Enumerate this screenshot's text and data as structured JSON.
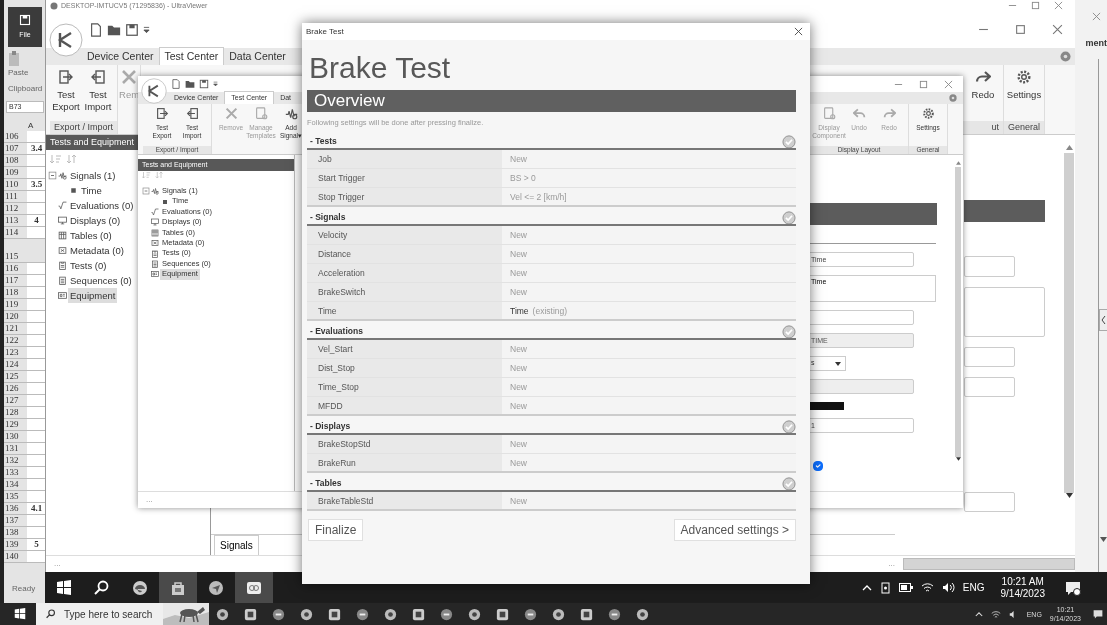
{
  "excel": {
    "file": "File",
    "paste": "Paste",
    "clipboard": "Clipboard",
    "name_box": "B73",
    "column": "A",
    "status": "Ready",
    "rows": [
      {
        "number": "106"
      },
      {
        "number": "107",
        "value": "3.4"
      },
      {
        "number": "108"
      },
      {
        "number": "109"
      },
      {
        "number": "110",
        "value": "3.5"
      },
      {
        "number": "111"
      },
      {
        "number": "112"
      },
      {
        "number": "113",
        "value": "4"
      },
      {
        "number": "114"
      },
      {
        "number": "115",
        "tall": true
      },
      {
        "number": "116"
      },
      {
        "number": "117"
      },
      {
        "number": "118"
      },
      {
        "number": "119"
      },
      {
        "number": "120"
      },
      {
        "number": "121"
      },
      {
        "number": "122"
      },
      {
        "number": "123"
      },
      {
        "number": "124"
      },
      {
        "number": "125"
      },
      {
        "number": "126"
      },
      {
        "number": "127"
      },
      {
        "number": "128"
      },
      {
        "number": "129"
      },
      {
        "number": "130"
      },
      {
        "number": "131"
      },
      {
        "number": "132"
      },
      {
        "number": "133"
      },
      {
        "number": "134"
      },
      {
        "number": "135"
      },
      {
        "number": "136",
        "value": "4.1"
      },
      {
        "number": "137"
      },
      {
        "number": "138"
      },
      {
        "number": "139",
        "value": "5"
      },
      {
        "number": "140"
      }
    ]
  },
  "viewer": {
    "title": "DESKTOP-IMTUCV5 (71295836) - UltraViewer"
  },
  "back_window": {
    "label": "ment"
  },
  "app": {
    "tabs": [
      {
        "label": "Device Center",
        "selected": false
      },
      {
        "label": "Test Center",
        "selected": true
      },
      {
        "label": "Data Center",
        "selected": false
      }
    ],
    "ribbon_groups": [
      {
        "label": "Export / Import",
        "items": [
          {
            "kind": "export",
            "label": "Test Export"
          },
          {
            "kind": "import",
            "label": "Test Import"
          }
        ]
      },
      {
        "items": [
          {
            "kind": "remove",
            "label": "Rem",
            "disabled": true
          }
        ]
      }
    ],
    "right_groups": [
      {
        "label": "ut",
        "items": [
          {
            "kind": "redo",
            "label": "Redo"
          }
        ]
      },
      {
        "label": "General",
        "items": [
          {
            "kind": "settings",
            "label": "Settings"
          }
        ]
      }
    ],
    "panel_title": "Tests and Equipment",
    "tree": [
      {
        "kind": "signal",
        "label": "Signals (1)",
        "expanded": true,
        "selected": false,
        "children": [
          {
            "kind": "channel",
            "label": "Time",
            "selected": false
          }
        ]
      },
      {
        "kind": "evaluation",
        "label": "Evaluations (0)",
        "selected": false
      },
      {
        "kind": "display",
        "label": "Displays (0)",
        "selected": false
      },
      {
        "kind": "table",
        "label": "Tables (0)",
        "selected": false
      },
      {
        "kind": "metadata",
        "label": "Metadata (0)",
        "selected": false
      },
      {
        "kind": "test",
        "label": "Tests (0)",
        "selected": false
      },
      {
        "kind": "sequence",
        "label": "Sequences (0)",
        "selected": false
      },
      {
        "kind": "equipment",
        "label": "Equipment",
        "selected": true
      }
    ],
    "bottom_tab": "Signals",
    "status": "...",
    "status_right": "..."
  },
  "inner": {
    "tabs": [
      {
        "label": "Device Center",
        "selected": false
      },
      {
        "label": "Test Center",
        "selected": true
      },
      {
        "label": "Dat",
        "selected": false
      }
    ],
    "ribbon_groups": [
      {
        "label": "Export / Import",
        "items": [
          {
            "kind": "export",
            "label": "Test Export"
          },
          {
            "kind": "import",
            "label": "Test Import"
          }
        ]
      },
      {
        "items": [
          {
            "kind": "remove",
            "label": "Remove",
            "disabled": true
          },
          {
            "kind": "template",
            "label": "Manage Templates",
            "disabled": true
          },
          {
            "kind": "signal",
            "label": "Add Signal▾"
          }
        ]
      }
    ],
    "right_groups": [
      {
        "label": "Display Layout",
        "items": [
          {
            "kind": "display",
            "label": "Display Component",
            "disabled": true
          },
          {
            "kind": "undo",
            "label": "Undo",
            "disabled": true
          },
          {
            "kind": "redo",
            "label": "Redo",
            "disabled": true
          }
        ]
      },
      {
        "label": "General",
        "items": [
          {
            "kind": "settings",
            "label": "Settings"
          }
        ]
      }
    ],
    "panel_title": "Tests and Equipment",
    "tree": [
      {
        "kind": "signal",
        "label": "Signals (1)",
        "expanded": true,
        "selected": false,
        "children": [
          {
            "kind": "channel",
            "label": "Time",
            "selected": false
          }
        ]
      },
      {
        "kind": "evaluation",
        "label": "Evaluations (0)",
        "selected": false
      },
      {
        "kind": "display",
        "label": "Displays (0)",
        "selected": false
      },
      {
        "kind": "table",
        "label": "Tables (0)",
        "selected": false
      },
      {
        "kind": "metadata",
        "label": "Metadata (0)",
        "selected": false
      },
      {
        "kind": "test",
        "label": "Tests (0)",
        "selected": false
      },
      {
        "kind": "sequence",
        "label": "Sequences (0)",
        "selected": false
      },
      {
        "kind": "equipment",
        "label": "Equipment",
        "selected": true
      }
    ],
    "form": [
      {
        "kind": "field",
        "value": "Time"
      },
      {
        "kind": "textarea",
        "value": "Time"
      },
      {
        "kind": "field"
      },
      {
        "kind": "field",
        "value": "TIME",
        "disabled": true
      },
      {
        "kind": "select",
        "value": "s"
      },
      {
        "kind": "field",
        "disabled": true
      },
      {
        "kind": "bar"
      },
      {
        "kind": "field",
        "value": "1"
      },
      {
        "kind": "checkbox",
        "checked": true
      }
    ],
    "status": "..."
  },
  "dialog": {
    "title": "Brake Test",
    "heading": "Brake Test",
    "overview": "Overview",
    "note": "Following settings will be done after pressing finalize.",
    "sections": [
      {
        "title": "- Tests",
        "rows": [
          {
            "label": "Job",
            "value": "New",
            "kind": "new"
          },
          {
            "label": "Start Trigger",
            "value": "BS > 0",
            "kind": "new"
          },
          {
            "label": "Stop Trigger",
            "value": "Vel <= 2 [km/h]",
            "kind": "new"
          }
        ]
      },
      {
        "title": "- Signals",
        "rows": [
          {
            "label": "Velocity",
            "value": "New",
            "kind": "new"
          },
          {
            "label": "Distance",
            "value": "New",
            "kind": "new"
          },
          {
            "label": "Acceleration",
            "value": "New",
            "kind": "new"
          },
          {
            "label": "BrakeSwitch",
            "value": "New",
            "kind": "new"
          },
          {
            "label": "Time",
            "value": "Time",
            "note": "(existing)",
            "kind": "existing"
          }
        ]
      },
      {
        "title": "- Evaluations",
        "rows": [
          {
            "label": "Vel_Start",
            "value": "New",
            "kind": "new"
          },
          {
            "label": "Dist_Stop",
            "value": "New",
            "kind": "new"
          },
          {
            "label": "Time_Stop",
            "value": "New",
            "kind": "new"
          },
          {
            "label": "MFDD",
            "value": "New",
            "kind": "new"
          }
        ]
      },
      {
        "title": "- Displays",
        "rows": [
          {
            "label": "BrakeStopStd",
            "value": "New",
            "kind": "new"
          },
          {
            "label": "BrakeRun",
            "value": "New",
            "kind": "new"
          }
        ]
      },
      {
        "title": "- Tables",
        "rows": [
          {
            "label": "BrakeTableStd",
            "value": "New",
            "kind": "new"
          }
        ]
      }
    ],
    "finalize": "Finalize",
    "advanced": "Advanced settings >"
  },
  "remote_taskbar": {
    "apps": [
      {
        "kind": "windows",
        "running": false
      },
      {
        "kind": "search",
        "running": false
      },
      {
        "kind": "browser",
        "running": false
      },
      {
        "kind": "store",
        "running": true
      },
      {
        "kind": "app",
        "running": false
      },
      {
        "kind": "viewer",
        "running": true
      }
    ],
    "language": "ENG",
    "time": "10:21 AM",
    "date": "9/14/2023"
  },
  "local_taskbar": {
    "placeholder": "Type here to search",
    "language": "ENG",
    "time": "10:21",
    "date": "9/14/2023"
  }
}
